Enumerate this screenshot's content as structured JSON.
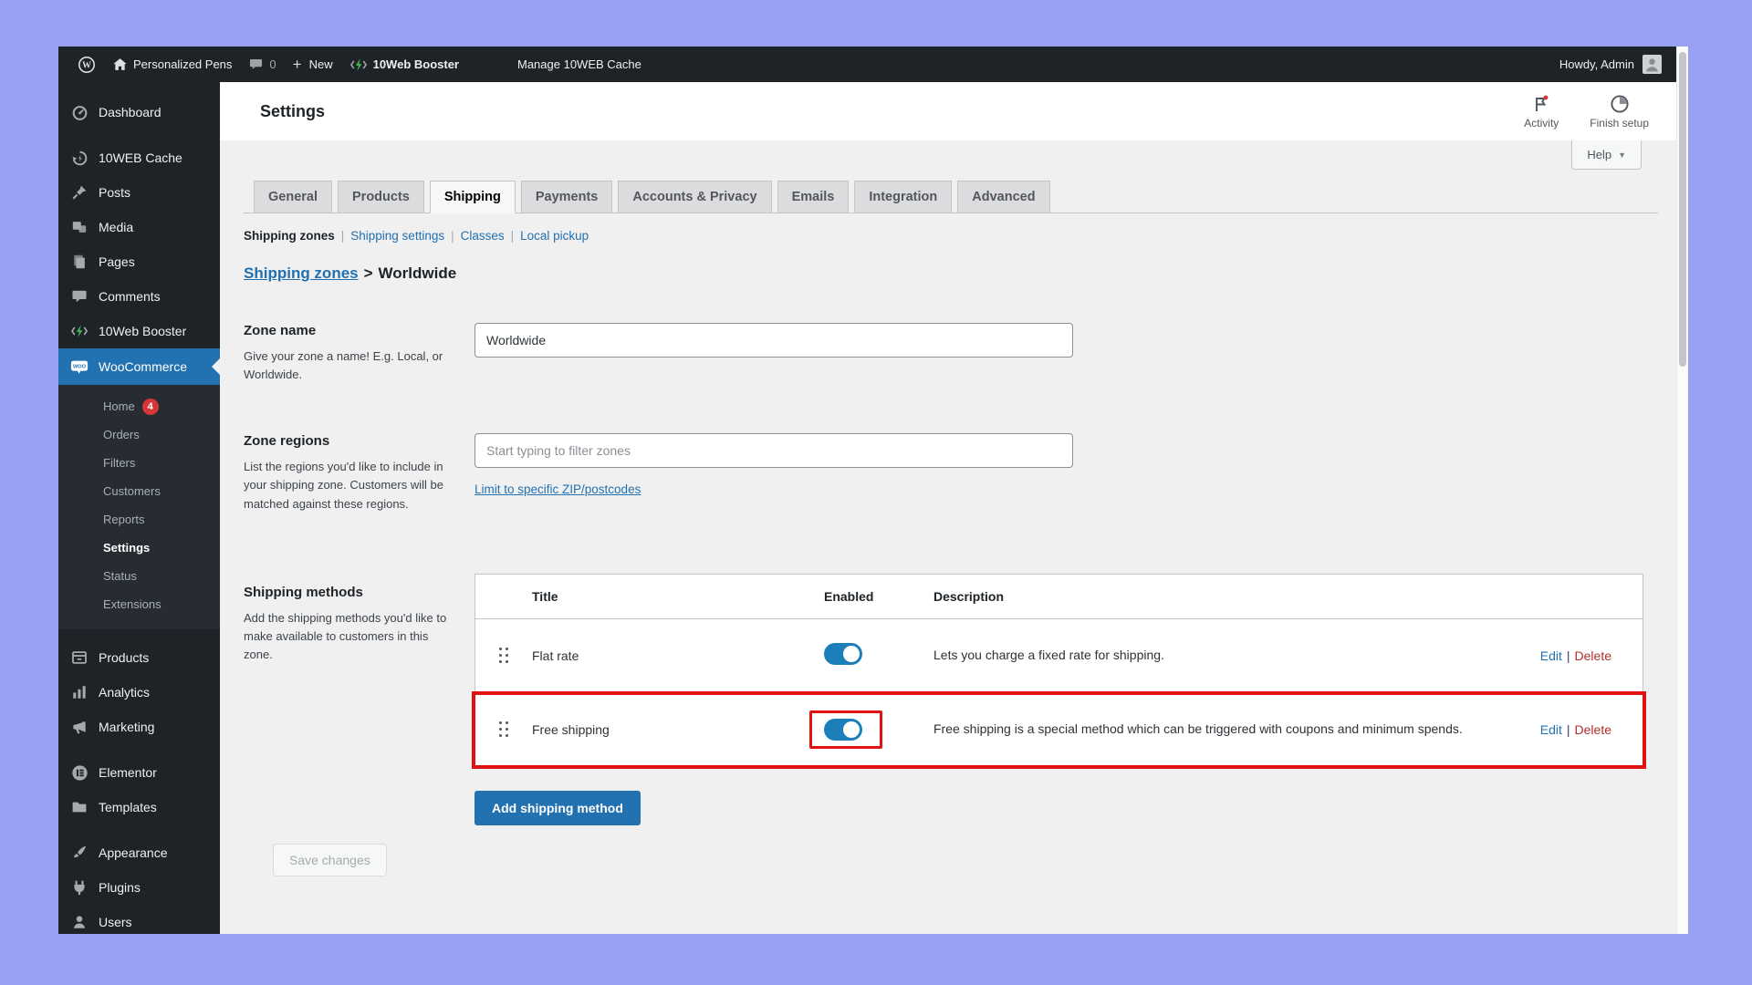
{
  "admin_bar": {
    "site_name": "Personalized Pens",
    "comments_count": "0",
    "new_label": "New",
    "booster_label": "10Web Booster",
    "manage_cache_label": "Manage 10WEB Cache",
    "howdy_label": "Howdy, Admin"
  },
  "sidebar": {
    "items_top": [
      {
        "label": "Dashboard"
      },
      {
        "label": "10WEB Cache"
      },
      {
        "label": "Posts"
      },
      {
        "label": "Media"
      },
      {
        "label": "Pages"
      },
      {
        "label": "Comments"
      },
      {
        "label": "10Web Booster"
      },
      {
        "label": "WooCommerce",
        "active": true
      }
    ],
    "woocommerce_submenu": [
      {
        "label": "Home",
        "badge": "4"
      },
      {
        "label": "Orders"
      },
      {
        "label": "Filters"
      },
      {
        "label": "Customers"
      },
      {
        "label": "Reports"
      },
      {
        "label": "Settings",
        "current": true
      },
      {
        "label": "Status"
      },
      {
        "label": "Extensions"
      }
    ],
    "items_bottom": [
      {
        "label": "Products"
      },
      {
        "label": "Analytics"
      },
      {
        "label": "Marketing"
      },
      {
        "label": "Elementor"
      },
      {
        "label": "Templates"
      },
      {
        "label": "Appearance"
      },
      {
        "label": "Plugins"
      },
      {
        "label": "Users"
      }
    ]
  },
  "header": {
    "title": "Settings",
    "activity_label": "Activity",
    "finish_setup_label": "Finish setup",
    "help_label": "Help"
  },
  "tabs": [
    {
      "label": "General"
    },
    {
      "label": "Products"
    },
    {
      "label": "Shipping",
      "active": true
    },
    {
      "label": "Payments"
    },
    {
      "label": "Accounts & Privacy"
    },
    {
      "label": "Emails"
    },
    {
      "label": "Integration"
    },
    {
      "label": "Advanced"
    }
  ],
  "subnav": [
    {
      "label": "Shipping zones",
      "current": true
    },
    {
      "label": "Shipping settings"
    },
    {
      "label": "Classes"
    },
    {
      "label": "Local pickup"
    }
  ],
  "breadcrumb": {
    "parent": "Shipping zones",
    "separator": ">",
    "current": "Worldwide"
  },
  "zone_name": {
    "heading": "Zone name",
    "description": "Give your zone a name! E.g. Local, or Worldwide.",
    "value": "Worldwide"
  },
  "zone_regions": {
    "heading": "Zone regions",
    "description": "List the regions you'd like to include in your shipping zone. Customers will be matched against these regions.",
    "placeholder": "Start typing to filter zones",
    "zip_link": "Limit to specific ZIP/postcodes"
  },
  "shipping_methods": {
    "heading": "Shipping methods",
    "description": "Add the shipping methods you'd like to make available to customers in this zone.",
    "columns": {
      "title": "Title",
      "enabled": "Enabled",
      "description": "Description"
    },
    "rows": [
      {
        "title": "Flat rate",
        "enabled": true,
        "description": "Lets you charge a fixed rate for shipping.",
        "edit_label": "Edit",
        "delete_label": "Delete",
        "highlighted": false
      },
      {
        "title": "Free shipping",
        "enabled": true,
        "description": "Free shipping is a special method which can be triggered with coupons and minimum spends.",
        "edit_label": "Edit",
        "delete_label": "Delete",
        "highlighted": true
      }
    ],
    "add_button_label": "Add shipping method"
  },
  "save_button_label": "Save changes",
  "colors": {
    "accent_blue": "#2271b1",
    "toggle_on": "#1d7fba",
    "annotation_red": "#e01212",
    "delete_red": "#b32d2e",
    "badge_red": "#d63638",
    "admin_dark": "#1d2327",
    "page_bg": "#f0f0f1",
    "desktop_bg": "#98a1f2"
  }
}
